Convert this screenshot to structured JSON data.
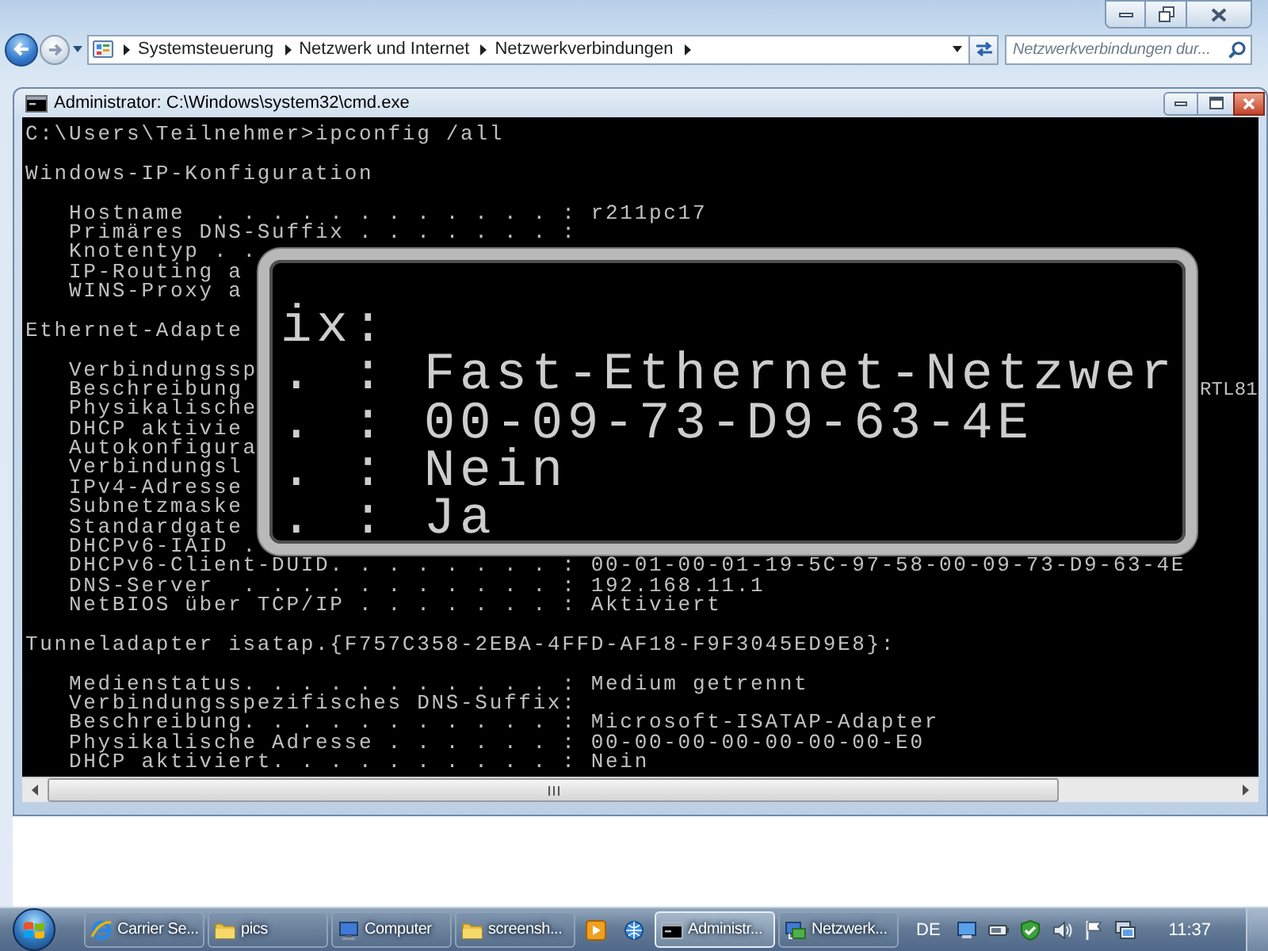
{
  "explorer": {
    "breadcrumbs": [
      {
        "label": "Systemsteuerung"
      },
      {
        "label": "Netzwerk und Internet"
      },
      {
        "label": "Netzwerkverbindungen"
      }
    ],
    "search": {
      "placeholder": "Netzwerkverbindungen dur..."
    }
  },
  "console": {
    "title": "Administrator: C:\\Windows\\system32\\cmd.exe",
    "sections": [
      {
        "heading": "C:\\Users\\Teilnehmer>ipconfig /all"
      },
      {
        "heading": "Windows-IP-Konfiguration",
        "entries": [
          {
            "text": "Hostname  . . . . . . . . . . . . : r211pc17"
          },
          {
            "text": "Primäres DNS-Suffix . . . . . . . :"
          },
          {
            "text": "Knotentyp . ."
          },
          {
            "text": "IP-Routing a"
          },
          {
            "text": "WINS-Proxy a"
          }
        ]
      },
      {
        "heading": "Ethernet-Adapte",
        "entries": [
          {
            "text": "Verbindungssp"
          },
          {
            "text": "Beschreibung",
            "tail": "RTL81"
          },
          {
            "text": "Physikalische"
          },
          {
            "text": "DHCP aktivie"
          },
          {
            "text": "Autokonfigura"
          },
          {
            "text": "Verbindungsl"
          },
          {
            "text": "IPv4-Adresse"
          },
          {
            "text": "Subnetzmaske"
          },
          {
            "text": "Standardgate"
          },
          {
            "text": "DHCPv6-IAID ."
          },
          {
            "text": "DHCPv6-Client-DUID. . . . . . . . : 00-01-00-01-19-5C-97-58-00-09-73-D9-63-4E"
          },
          {
            "text": "DNS-Server  . . . . . . . . . . . : 192.168.11.1"
          },
          {
            "text": "NetBIOS über TCP/IP . . . . . . . : Aktiviert"
          }
        ]
      },
      {
        "heading": "Tunneladapter isatap.{F757C358-2EBA-4FFD-AF18-F9F3045ED9E8}:",
        "entries": [
          {
            "text": "Medienstatus. . . . . . . . . . . : Medium getrennt"
          },
          {
            "text": "Verbindungsspezifisches DNS-Suffix:"
          },
          {
            "text": "Beschreibung. . . . . . . . . . . : Microsoft-ISATAP-Adapter"
          },
          {
            "text": "Physikalische Adresse . . . . . . : 00-00-00-00-00-00-00-E0"
          },
          {
            "text": "DHCP aktiviert. . . . . . . . . . : Nein"
          }
        ]
      }
    ]
  },
  "magnifier": {
    "lines": [
      "ix:",
      ". : Fast-Ethernet-Netzwer",
      ". : 00-09-73-D9-63-4E",
      ". : Nein",
      ". : Ja"
    ]
  },
  "taskbar": {
    "items": [
      {
        "kind": "browser",
        "label": "Carrier Se...",
        "active": false
      },
      {
        "kind": "folder",
        "label": "pics",
        "active": false
      },
      {
        "kind": "computer",
        "label": "Computer",
        "active": false
      },
      {
        "kind": "folder",
        "label": "screensh...",
        "active": false
      },
      {
        "kind": "player",
        "active": false
      },
      {
        "kind": "remote",
        "active": false
      },
      {
        "kind": "console",
        "label": "Administr...",
        "active": true
      },
      {
        "kind": "network",
        "label": "Netzwerk...",
        "active": false
      }
    ],
    "language": "DE",
    "clock": "11:37"
  }
}
